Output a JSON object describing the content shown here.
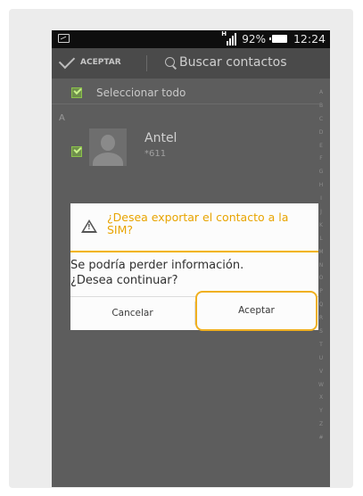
{
  "status_bar": {
    "network_type": "H",
    "battery_percent": "92%",
    "time": "12:24"
  },
  "action_bar": {
    "accept_label": "ACEPTAR",
    "search_placeholder": "Buscar contactos"
  },
  "list": {
    "select_all_label": "Seleccionar todo",
    "select_all_checked": true,
    "section_letter": "A",
    "contacts": [
      {
        "name": "Antel",
        "number": "*611",
        "checked": true
      }
    ]
  },
  "alphabet_index": [
    "A",
    "B",
    "C",
    "D",
    "E",
    "F",
    "G",
    "H",
    "I",
    "J",
    "K",
    "L",
    "M",
    "N",
    "O",
    "P",
    "Q",
    "R",
    "S",
    "T",
    "U",
    "V",
    "W",
    "X",
    "Y",
    "Z",
    "#"
  ],
  "dialog": {
    "title": "¿Desea exportar el contacto a la SIM?",
    "message_line1": "Se podría perder información.",
    "message_line2": "¿Desea continuar?",
    "cancel_label": "Cancelar",
    "accept_label": "Aceptar"
  },
  "colors": {
    "dialog_accent": "#e8a400",
    "highlight_border": "#f0b020",
    "checkbox_green": "#8bc34a"
  }
}
